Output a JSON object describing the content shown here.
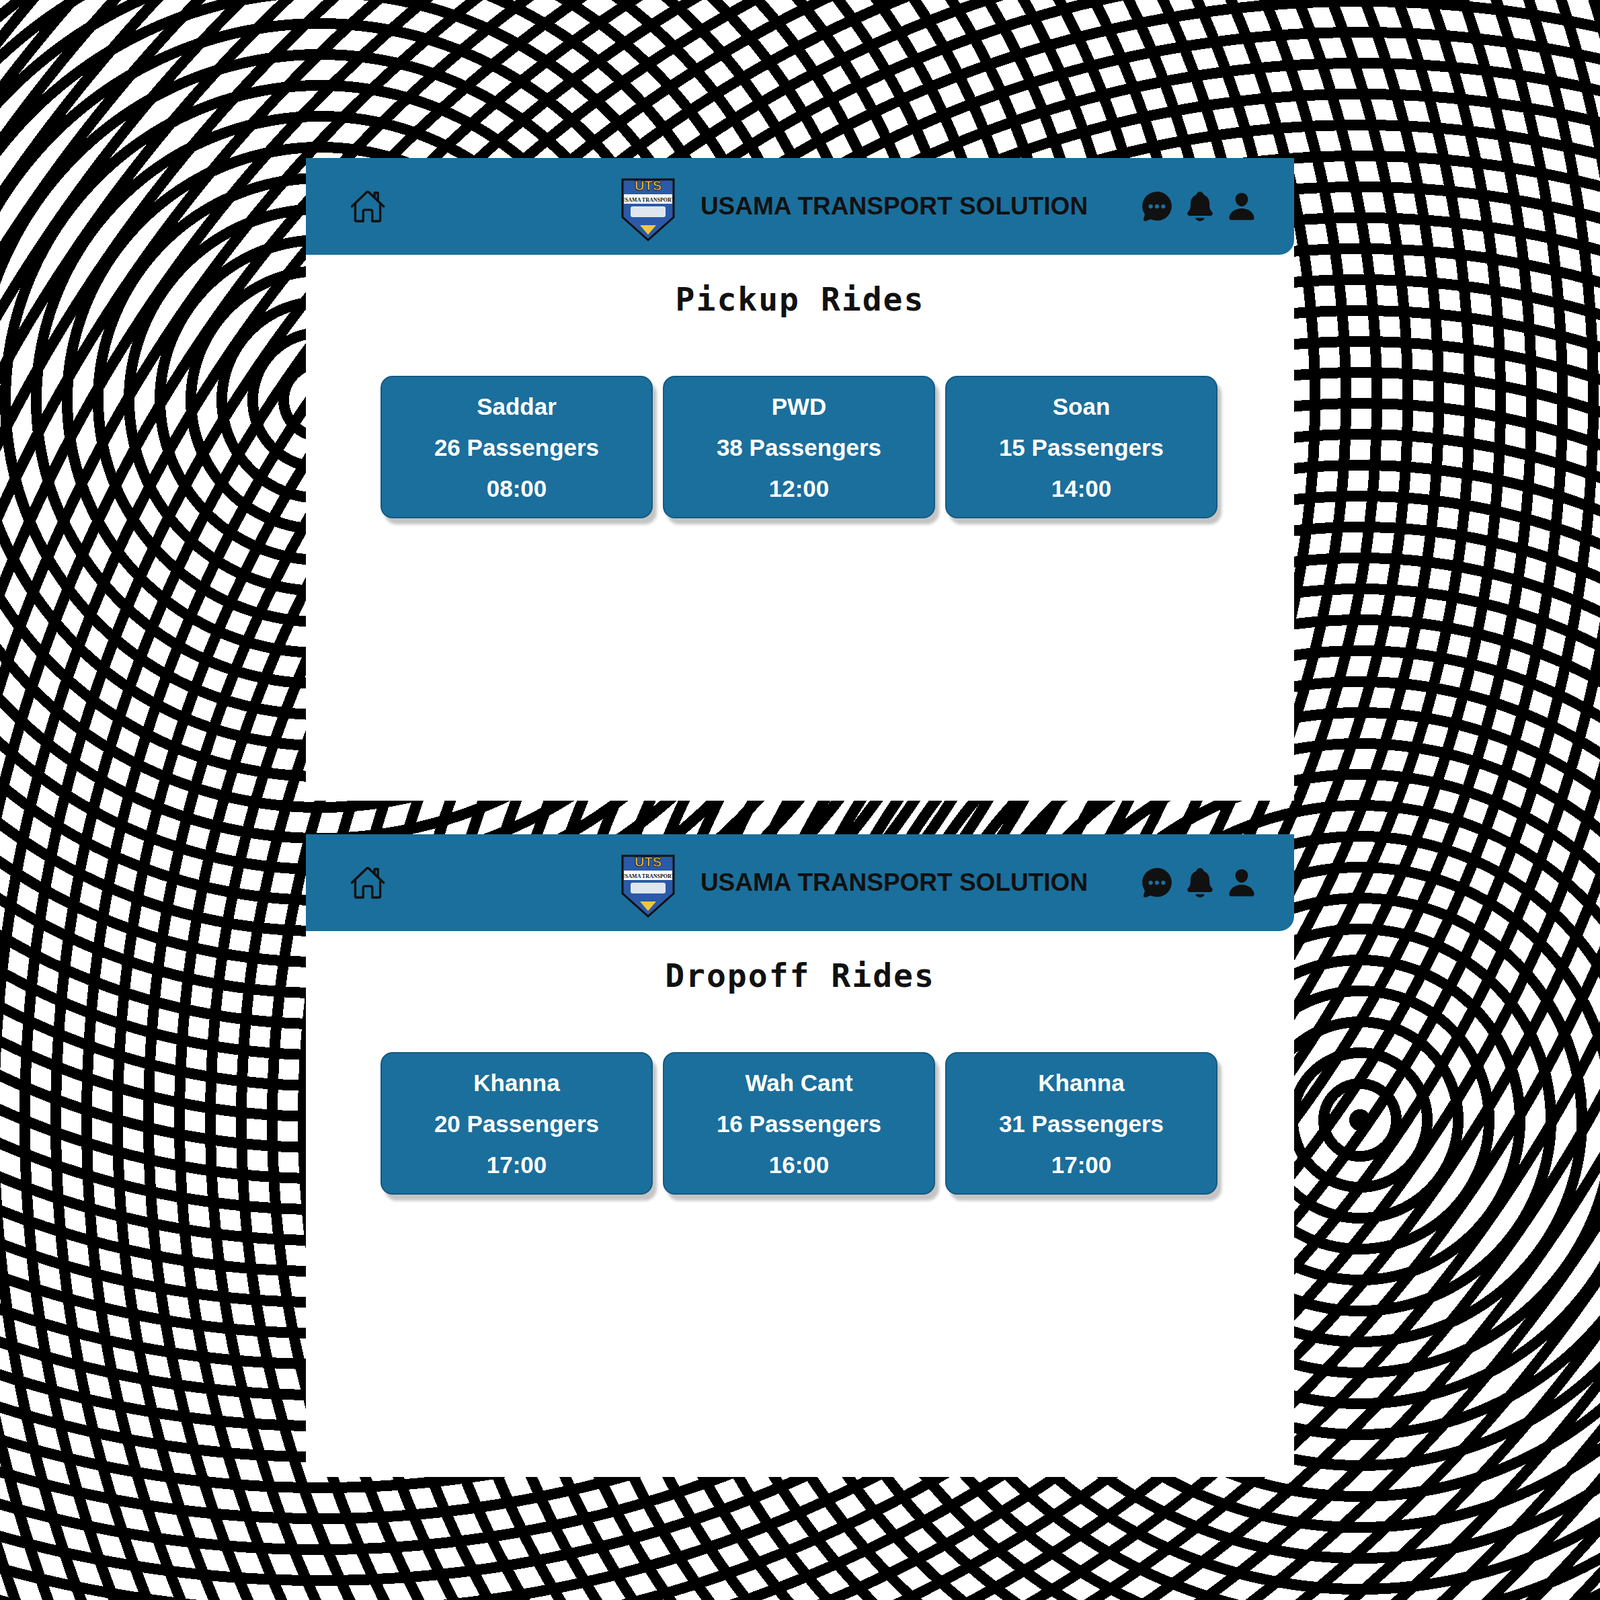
{
  "screens": [
    {
      "header": {
        "title": "USAMA TRANSPORT SOLUTION",
        "logo": {
          "initials": "UTS",
          "caption": "USAMA TRANSPORT"
        }
      },
      "heading": "Pickup Rides",
      "rides": [
        {
          "place": "Saddar",
          "passengers": "26 Passengers",
          "time": "08:00"
        },
        {
          "place": "PWD",
          "passengers": "38 Passengers",
          "time": "12:00"
        },
        {
          "place": "Soan",
          "passengers": "15 Passengers",
          "time": "14:00"
        }
      ]
    },
    {
      "header": {
        "title": "USAMA TRANSPORT SOLUTION",
        "logo": {
          "initials": "UTS",
          "caption": "USAMA TRANSPORT"
        }
      },
      "heading": "Dropoff Rides",
      "rides": [
        {
          "place": "Khanna",
          "passengers": "20 Passengers",
          "time": "17:00"
        },
        {
          "place": "Wah Cant",
          "passengers": "16 Passengers",
          "time": "16:00"
        },
        {
          "place": "Khanna",
          "passengers": "31 Passengers",
          "time": "17:00"
        }
      ]
    }
  ]
}
